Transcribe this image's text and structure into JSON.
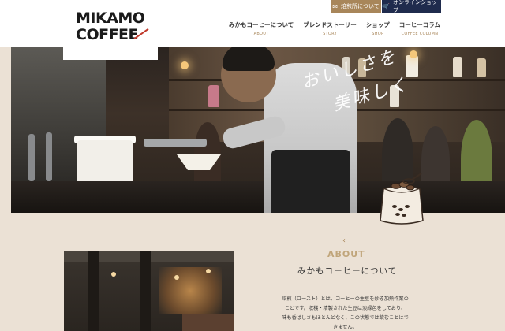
{
  "header": {
    "logo": {
      "line1": "MIKAMO",
      "line2": "COFFEE"
    },
    "top_buttons": {
      "shop_info": {
        "label": "焙煎所について",
        "icon": "mail-icon"
      },
      "online_shop": {
        "label": "オンラインショップ",
        "icon": "cart-icon"
      }
    },
    "nav": [
      {
        "jp": "みかもコーヒーについて",
        "en": "ABOUT"
      },
      {
        "jp": "ブレンドストーリー",
        "en": "STORY"
      },
      {
        "jp": "ショップ",
        "en": "SHOP"
      },
      {
        "jp": "コーヒーコラム",
        "en": "COFFEE COLUMN"
      }
    ]
  },
  "hero": {
    "calligraphy_line1": "おいしさを",
    "calligraphy_line2": "美味しく"
  },
  "about": {
    "en": "ABOUT",
    "jp": "みかもコーヒーについて",
    "body_line1": "焙煎（ロースト）とは、コーヒーの生豆を炒る加熱作業の",
    "body_line2": "ことです。収穫・精製された生豆は淡緑色をしており、",
    "body_line3": "味も香ばしさもほとんどなく、この状態では飲むことはで",
    "body_line4": "きません。"
  },
  "colors": {
    "accent": "#a8865a",
    "navy": "#1f2b4d",
    "background": "#ebe1d5"
  }
}
